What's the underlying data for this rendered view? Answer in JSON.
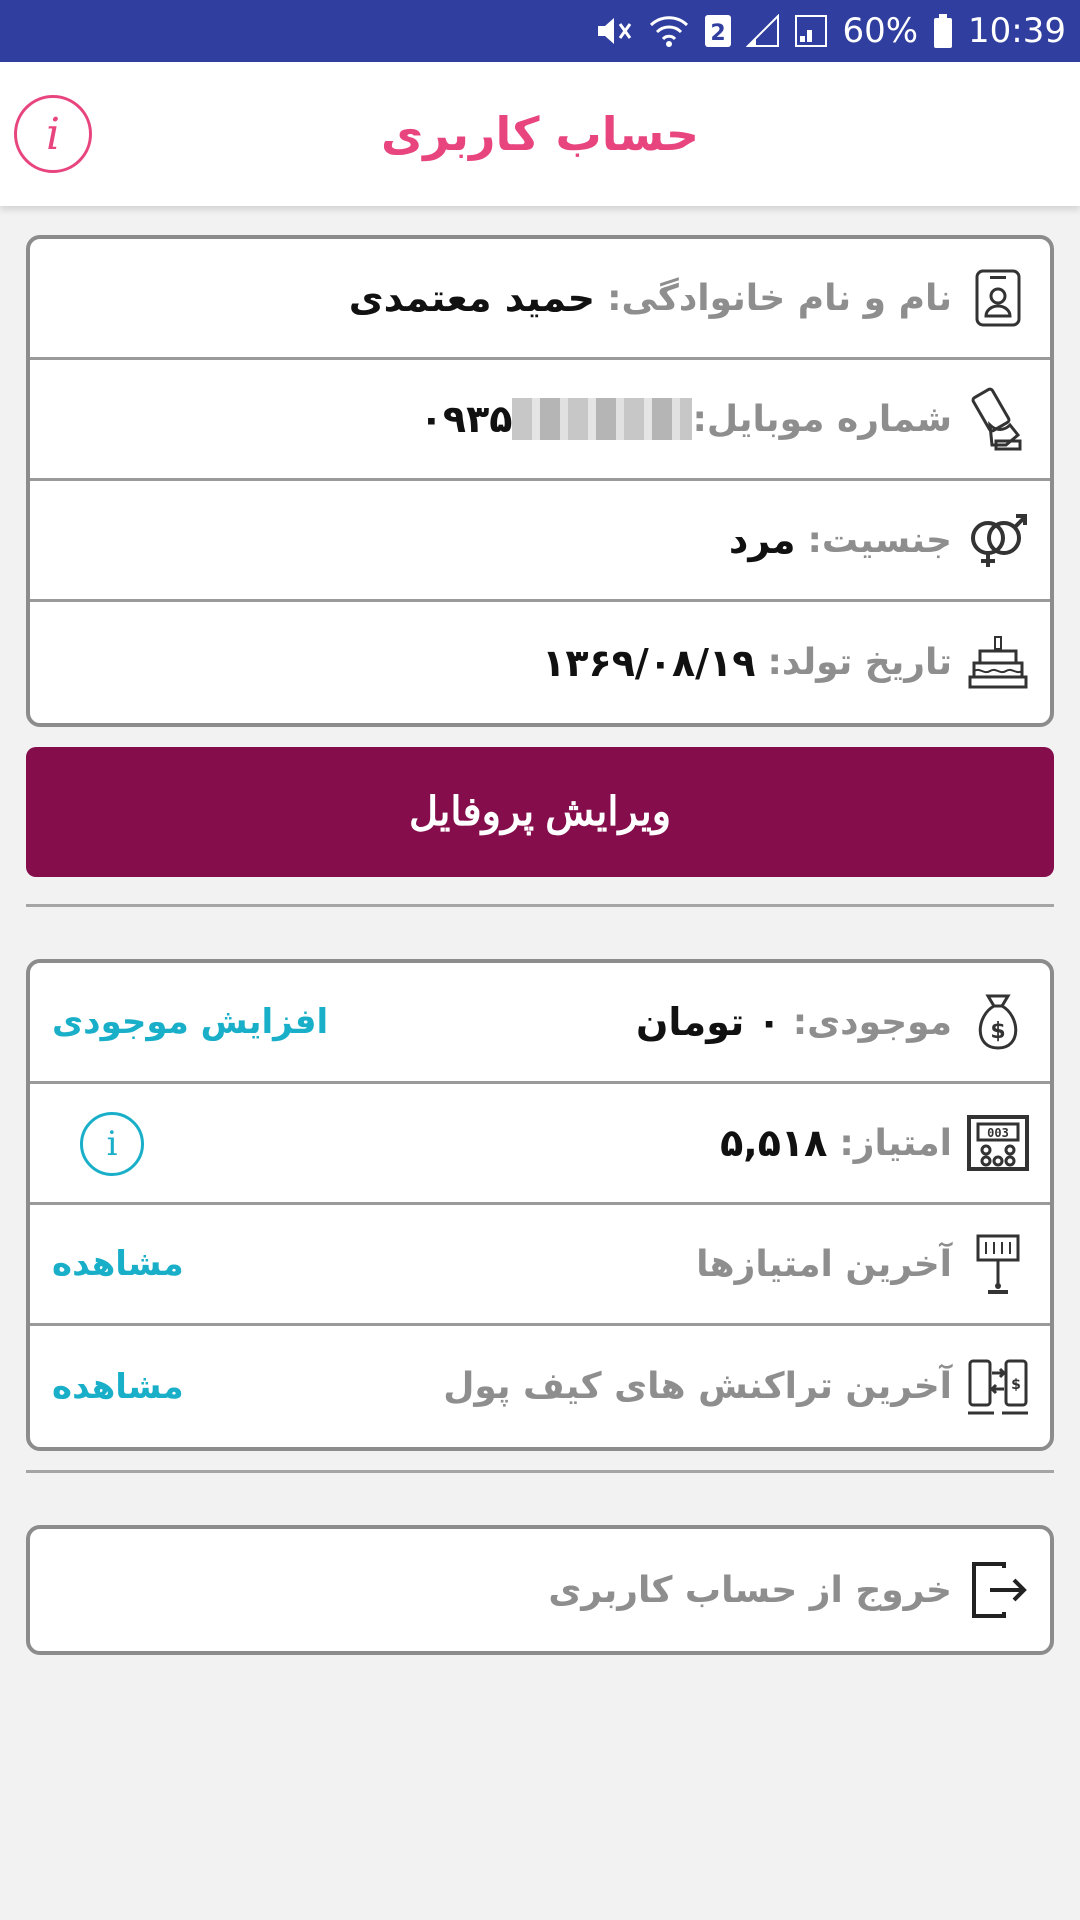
{
  "status_bar": {
    "battery": "60%",
    "time": "10:39",
    "sim_badge": "2",
    "icons": [
      "mute-icon",
      "wifi-icon",
      "sim-icon",
      "signal-icon",
      "battery-icon"
    ]
  },
  "app_bar": {
    "title": "حساب کاربری",
    "info_icon": "i"
  },
  "profile": {
    "name": {
      "label": "نام و نام خانوادگی:",
      "value": "حمید معتمدی",
      "icon": "id-card-icon"
    },
    "mobile": {
      "label": "شماره موبایل:",
      "value": "۰۹۳۵",
      "icon": "mobile-hand-icon"
    },
    "gender": {
      "label": "جنسیت:",
      "value": "مرد",
      "icon": "gender-icon"
    },
    "birthday": {
      "label": "تاریخ تولد:",
      "value": "۱۳۶۹/۰۸/۱۹",
      "icon": "cake-icon"
    }
  },
  "edit_button": "ویرایش پروفایل",
  "wallet": {
    "balance": {
      "label": "موجودی:",
      "value": "۰ تومان",
      "action": "افزایش موجودی",
      "icon": "money-bag-icon"
    },
    "points": {
      "label": "امتیاز:",
      "value": "۵,۵۱۸",
      "icon": "score-board-icon",
      "info_icon": "i"
    },
    "last_points": {
      "label": "آخرین امتیازها",
      "action": "مشاهده",
      "icon": "points-history-icon"
    },
    "last_transactions": {
      "label": "آخرین تراکنش های کیف پول",
      "action": "مشاهده",
      "icon": "wallet-transfer-icon"
    }
  },
  "logout": {
    "label": "خروج از حساب کاربری",
    "icon": "logout-icon"
  },
  "colors": {
    "status_bar": "#303f9f",
    "title_pink": "#e8457f",
    "edit_button": "#850d4c",
    "link_cyan": "#1aafc8",
    "label_gray": "#8e8e8e"
  }
}
